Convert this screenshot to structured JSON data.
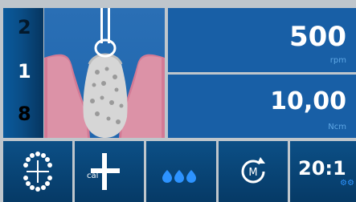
{
  "steps": [
    "2",
    "1",
    "8"
  ],
  "speed": {
    "value": "500",
    "unit": "rpm"
  },
  "torque": {
    "value": "10,00",
    "unit": "Ncm"
  },
  "buttons": {
    "calibrate_label": "cal",
    "ratio": "20:1",
    "mode_letter": "M"
  },
  "colors": {
    "panel_blue": "#185fa6",
    "active_step": "#ffffff",
    "unit_text": "#5ea7e5"
  },
  "icons": [
    "tooth-chart-icon",
    "calibrate-icon",
    "irrigation-icon",
    "rotation-mode-icon",
    "gear-icon"
  ]
}
